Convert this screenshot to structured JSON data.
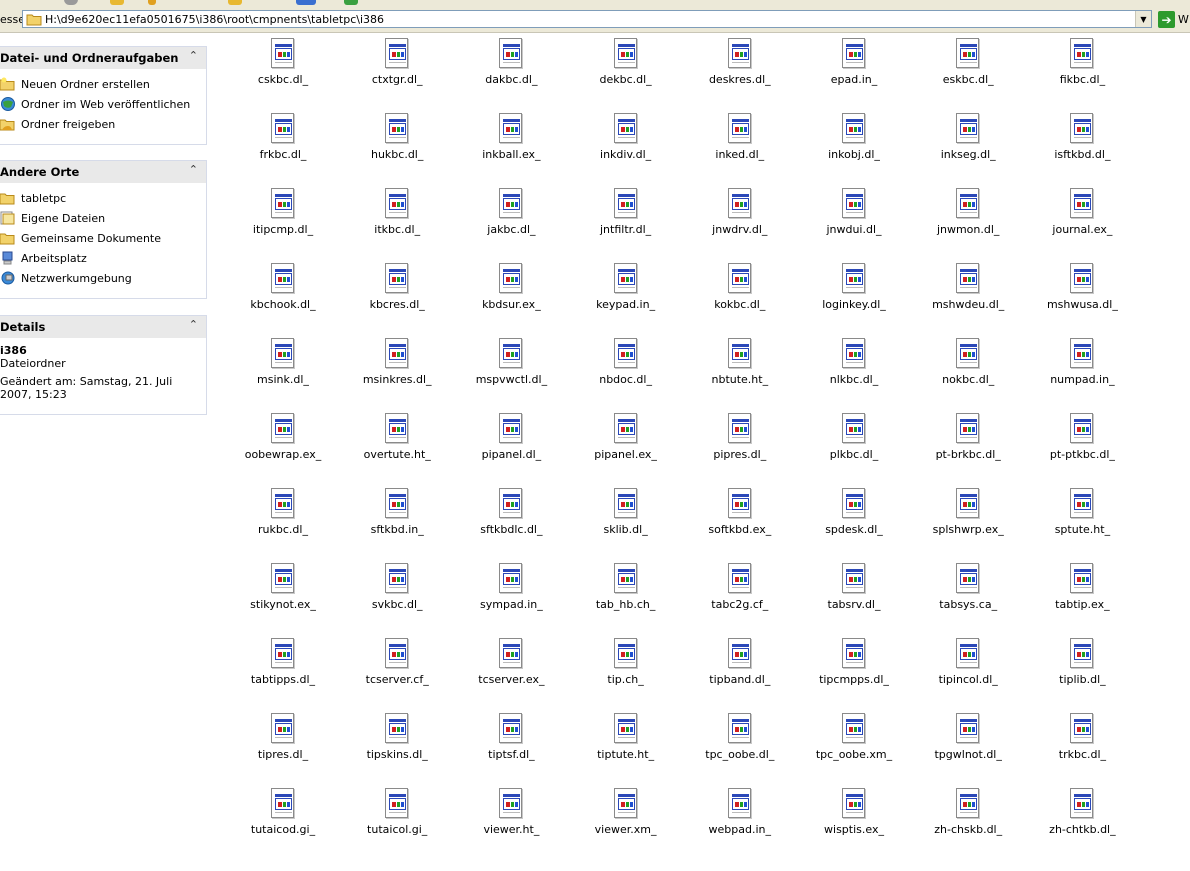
{
  "address_bar": {
    "label": "esse",
    "path": "H:\\d9e620ec11efa0501675\\i386\\root\\cmpnents\\tabletpc\\i386",
    "go_label": "W"
  },
  "task_pane": {
    "file_tasks": {
      "title": "Datei- und Ordneraufgaben",
      "items": [
        {
          "label": "Neuen Ordner erstellen",
          "icon": "new-folder-icon"
        },
        {
          "label": "Ordner im Web veröffentlichen",
          "icon": "web-publish-icon"
        },
        {
          "label": "Ordner freigeben",
          "icon": "share-folder-icon"
        }
      ]
    },
    "other_places": {
      "title": "Andere Orte",
      "items": [
        {
          "label": "tabletpc",
          "icon": "folder-icon"
        },
        {
          "label": "Eigene Dateien",
          "icon": "my-documents-icon"
        },
        {
          "label": "Gemeinsame Dokumente",
          "icon": "folder-icon"
        },
        {
          "label": "Arbeitsplatz",
          "icon": "my-computer-icon"
        },
        {
          "label": "Netzwerkumgebung",
          "icon": "network-icon"
        }
      ]
    },
    "details": {
      "title": "Details",
      "name": "i386",
      "type": "Dateiordner",
      "modified": "Geändert am: Samstag, 21. Juli 2007, 15:23"
    }
  },
  "files": [
    "cskbc.dl_",
    "ctxtgr.dl_",
    "dakbc.dl_",
    "dekbc.dl_",
    "deskres.dl_",
    "epad.in_",
    "eskbc.dl_",
    "fikbc.dl_",
    "frkbc.dl_",
    "hukbc.dl_",
    "inkball.ex_",
    "inkdiv.dl_",
    "inked.dl_",
    "inkobj.dl_",
    "inkseg.dl_",
    "isftkbd.dl_",
    "itipcmp.dl_",
    "itkbc.dl_",
    "jakbc.dl_",
    "jntfiltr.dl_",
    "jnwdrv.dl_",
    "jnwdui.dl_",
    "jnwmon.dl_",
    "journal.ex_",
    "kbchook.dl_",
    "kbcres.dl_",
    "kbdsur.ex_",
    "keypad.in_",
    "kokbc.dl_",
    "loginkey.dl_",
    "mshwdeu.dl_",
    "mshwusa.dl_",
    "msink.dl_",
    "msinkres.dl_",
    "mspvwctl.dl_",
    "nbdoc.dl_",
    "nbtute.ht_",
    "nlkbc.dl_",
    "nokbc.dl_",
    "numpad.in_",
    "oobewrap.ex_",
    "overtute.ht_",
    "pipanel.dl_",
    "pipanel.ex_",
    "pipres.dl_",
    "plkbc.dl_",
    "pt-brkbc.dl_",
    "pt-ptkbc.dl_",
    "rukbc.dl_",
    "sftkbd.in_",
    "sftkbdlc.dl_",
    "sklib.dl_",
    "softkbd.ex_",
    "spdesk.dl_",
    "splshwrp.ex_",
    "sptute.ht_",
    "stikynot.ex_",
    "svkbc.dl_",
    "sympad.in_",
    "tab_hb.ch_",
    "tabc2g.cf_",
    "tabsrv.dl_",
    "tabsys.ca_",
    "tabtip.ex_",
    "tabtipps.dl_",
    "tcserver.cf_",
    "tcserver.ex_",
    "tip.ch_",
    "tipband.dl_",
    "tipcmpps.dl_",
    "tipincol.dl_",
    "tiplib.dl_",
    "tipres.dl_",
    "tipskins.dl_",
    "tiptsf.dl_",
    "tiptute.ht_",
    "tpc_oobe.dl_",
    "tpc_oobe.xm_",
    "tpgwlnot.dl_",
    "trkbc.dl_",
    "tutaicod.gi_",
    "tutaicol.gi_",
    "viewer.ht_",
    "viewer.xm_",
    "webpad.in_",
    "wisptis.ex_",
    "zh-chskb.dl_",
    "zh-chtkb.dl_"
  ],
  "file_icon": "system-file-icon"
}
